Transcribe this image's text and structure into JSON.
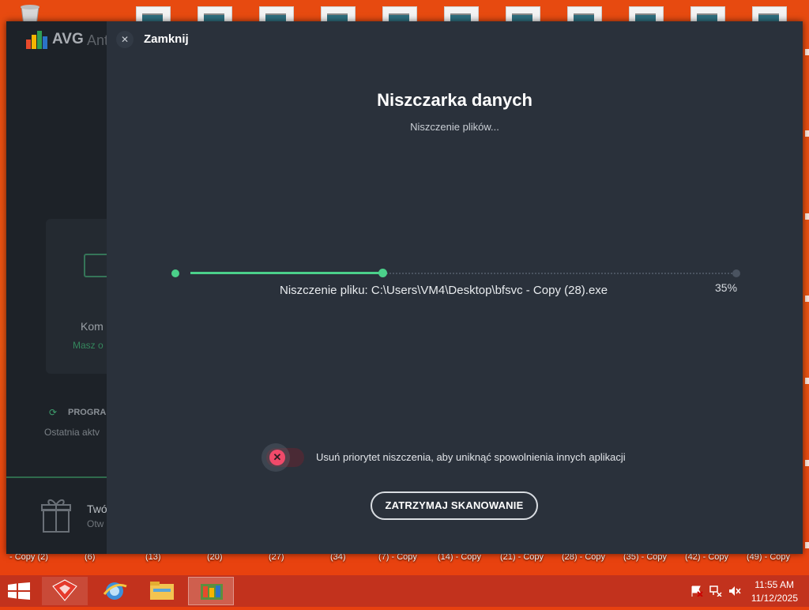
{
  "desktop": {
    "icon_labels": [
      "- Copy (2)",
      "(6)",
      "(13)",
      "(20)",
      "(27)",
      "(34)",
      "(7) - Copy",
      "(14) - Copy",
      "(21) - Copy",
      "(28) - Copy",
      "(35) - Copy",
      "(42) - Copy",
      "(49) - Copy"
    ]
  },
  "avg": {
    "brand": "AVG",
    "brand_rest": "Ant",
    "sidebar": {
      "card_title": "Kom",
      "card_subtitle": "Masz o",
      "section_label": "PROGRA",
      "last_activity": "Ostatnia aktv",
      "promo_title": "Twó",
      "promo_subtitle": "Otw"
    }
  },
  "shredder": {
    "close_label": "Zamknij",
    "title": "Niszczarka danych",
    "subtitle": "Niszczenie plików...",
    "current_file": "Niszczenie pliku: C:\\Users\\VM4\\Desktop\\bfsvc - Copy (28).exe",
    "progress_percent": 35,
    "progress_label": "35%",
    "priority_toggle_label": "Usuń priorytet niszczenia, aby uniknąć spowolnienia innych aplikacji",
    "priority_toggle_on": false,
    "stop_button": "ZATRZYMAJ SKANOWANIE",
    "colors": {
      "accent": "#4bd08a",
      "toggle_off": "#f04a6a",
      "panel": "#2a313b"
    }
  },
  "taskbar": {
    "apps": [
      "avg-secure-browser-icon",
      "internet-explorer-icon",
      "file-explorer-icon",
      "avg-antivirus-icon"
    ],
    "clock_time": "11:55 AM",
    "clock_date": "11/12/2025"
  }
}
